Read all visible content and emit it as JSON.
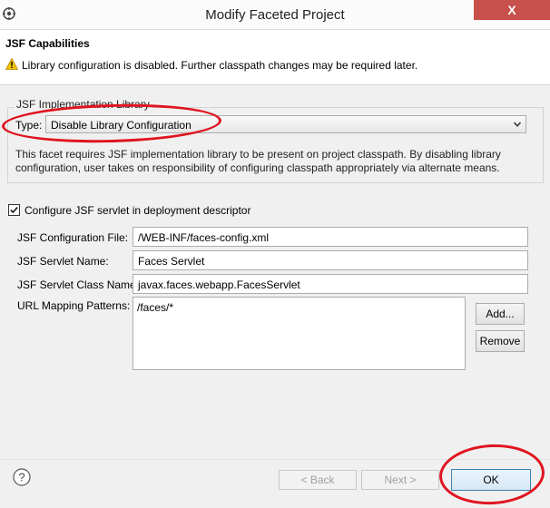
{
  "window": {
    "title": "Modify Faceted Project",
    "close_label": "X"
  },
  "header": {
    "title": "JSF Capabilities",
    "warning": "Library configuration is disabled. Further classpath changes may be required later."
  },
  "implementation": {
    "group_label": "JSF Implementation Library",
    "type_label": "Type:",
    "type_value": "Disable Library Configuration",
    "description_1": "This facet requires JSF implementation library to be present on project classpath. By disabling library",
    "description_2": "configuration, user takes on responsibility of configuring classpath appropriately via alternate means."
  },
  "servlet": {
    "configure_label": "Configure JSF servlet in deployment descriptor",
    "configure_checked": true,
    "config_file_label": "JSF Configuration File:",
    "config_file_value": "/WEB-INF/faces-config.xml",
    "servlet_name_label": "JSF Servlet Name:",
    "servlet_name_value": "Faces Servlet",
    "servlet_class_label": "JSF Servlet Class Name:",
    "servlet_class_value": "javax.faces.webapp.FacesServlet",
    "url_mapping_label": "URL Mapping Patterns:",
    "url_patterns": [
      "/faces/*"
    ],
    "add_label": "Add...",
    "remove_label": "Remove"
  },
  "footer": {
    "back_label": "< Back",
    "next_label": "Next >",
    "ok_label": "OK"
  },
  "annotations": {
    "color": "#e0141e"
  }
}
